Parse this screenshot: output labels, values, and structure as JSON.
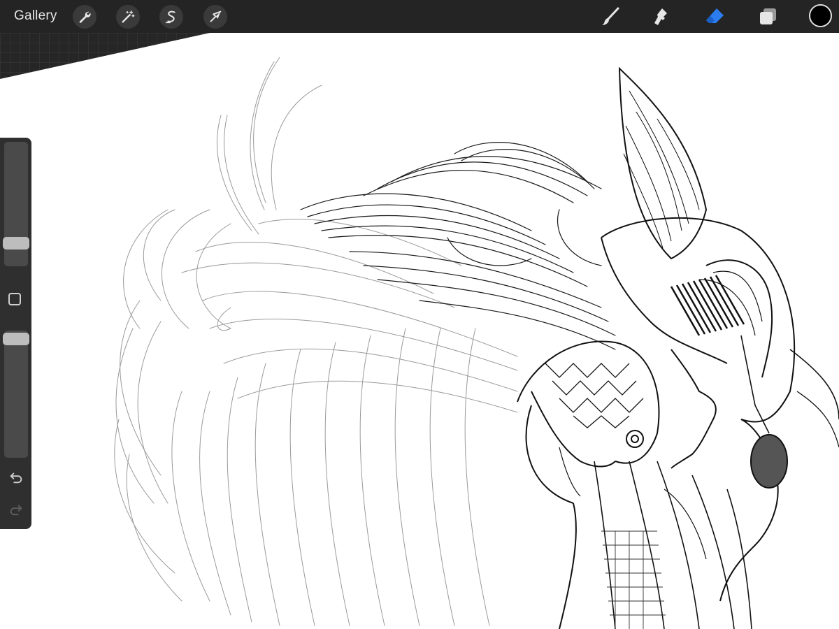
{
  "toolbar": {
    "gallery_label": "Gallery",
    "left_tools": [
      {
        "icon": "wrench-icon",
        "name": "actions"
      },
      {
        "icon": "magic-wand-icon",
        "name": "adjustments"
      },
      {
        "icon": "selection-s-icon",
        "name": "selection"
      },
      {
        "icon": "arrow-cursor-icon",
        "name": "transform"
      }
    ],
    "right_tools": [
      {
        "icon": "brush-icon",
        "name": "paint",
        "active": false
      },
      {
        "icon": "smudge-icon",
        "name": "smudge",
        "active": false
      },
      {
        "icon": "eraser-icon",
        "name": "eraser",
        "active": true
      },
      {
        "icon": "layers-icon",
        "name": "layers",
        "active": false
      }
    ],
    "current_color": "#000000",
    "active_color": "#2b7cf0",
    "icon_color": "#e6e6e6"
  },
  "sidebar": {
    "brush_size": 0.15,
    "opacity": 0.98,
    "icons": [
      "modify-square-icon",
      "undo-icon",
      "redo-icon"
    ]
  }
}
